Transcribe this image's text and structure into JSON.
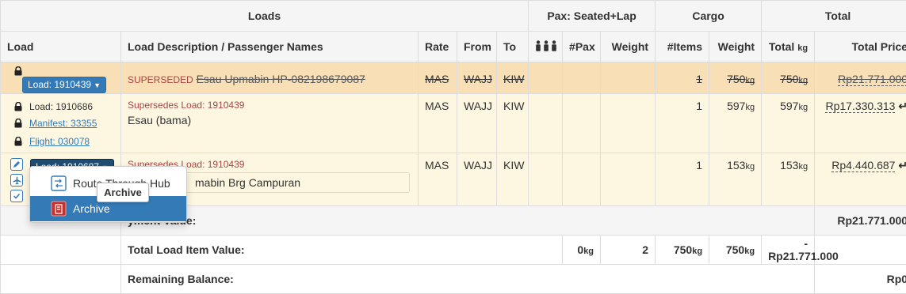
{
  "groups": {
    "loads": "Loads",
    "pax": "Pax: Seated+Lap",
    "cargo": "Cargo",
    "total": "Total"
  },
  "columns": {
    "load": "Load",
    "description": "Load Description / Passenger Names",
    "rate": "Rate",
    "from": "From",
    "to": "To",
    "pax": "#Pax",
    "weight": "Weight",
    "items": "#Items",
    "cargo_weight": "Weight",
    "total": "Total",
    "total_unit": "kg",
    "total_price": "Total Price"
  },
  "rows": [
    {
      "load_button": "Load: 1910439",
      "status": "SUPERSEDED",
      "description": "Esau Upmabin HP-082198679087",
      "rate": "MAS",
      "from": "WAJJ",
      "to": "KIW",
      "items": "1",
      "weight": "750",
      "total": "750",
      "unit": "kg",
      "price": "Rp21.771.000"
    },
    {
      "load_label": "Load: 1910686",
      "manifest": "Manifest: 33355",
      "flight": "Flight: 030078",
      "supersedes": "Supersedes Load: 1910439",
      "description": "Esau (bama)",
      "rate": "MAS",
      "from": "WAJJ",
      "to": "KIW",
      "items": "1",
      "weight": "597",
      "total": "597",
      "unit": "kg",
      "price": "Rp17.330.313"
    },
    {
      "load_button": "Load: 1910687",
      "supersedes": "Supersedes Load: 1910439",
      "description": "mabin Brg Campuran",
      "rate": "MAS",
      "from": "WAJJ",
      "to": "KIW",
      "items": "1",
      "weight": "153",
      "total": "153",
      "unit": "kg",
      "price": "Rp4.440.687"
    }
  ],
  "summary": {
    "payment_label": "yment Value:",
    "payment_value": "Rp21.771.000",
    "item_label": "Total Load Item Value:",
    "item_pax_weight": "0",
    "item_count": "2",
    "item_cargo_weight": "750",
    "item_total_weight": "750",
    "item_unit": "kg",
    "item_value": "-Rp21.771.000",
    "remaining_label": "Remaining Balance:",
    "remaining_value": "Rp0"
  },
  "dropdown": {
    "items": [
      "Route Through Hub",
      "Archive"
    ]
  },
  "tooltip": "Archive",
  "colors": {
    "superseded_row": "#f8dfb6",
    "active_row": "#fdf7e1",
    "primary": "#337ab7",
    "danger_text": "#a94442"
  }
}
